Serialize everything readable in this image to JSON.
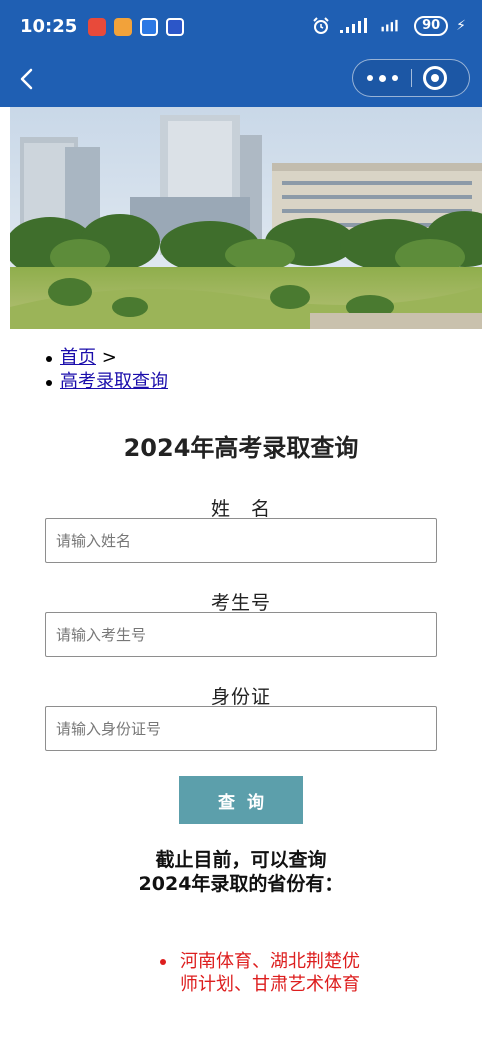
{
  "status_bar": {
    "time": "10:25",
    "battery": "90",
    "icons": [
      "app-notification-icon",
      "app-notification-icon",
      "app-notification-icon",
      "app-notification-icon",
      "alarm-icon",
      "signal-icon",
      "signal-icon",
      "battery-icon",
      "charging-icon"
    ]
  },
  "nav": {
    "back_icon": "chevron-left-icon",
    "more_icon": "more-dots-icon",
    "close_icon": "target-circle-icon"
  },
  "breadcrumb": [
    {
      "label": "首页",
      "suffix": " >"
    },
    {
      "label": "高考录取查询",
      "suffix": ""
    }
  ],
  "page": {
    "title": "2024年高考录取查询"
  },
  "form": {
    "name_label": "姓　名",
    "name_placeholder": "请输入姓名",
    "exam_label": "考生号",
    "exam_placeholder": "请输入考生号",
    "id_label": "身份证",
    "id_placeholder": "请输入身份证号",
    "submit_label": "查询"
  },
  "notice": {
    "text": "截止目前，可以查询2024年录取的省份有：",
    "provinces": [
      "河南体育、湖北荆楚优师计划、甘肃艺术体育"
    ]
  },
  "colors": {
    "nav_bg": "#1f5fb3",
    "button_bg": "#5c9fab",
    "province_text": "#dd1e1e",
    "link": "#1a0dab"
  }
}
